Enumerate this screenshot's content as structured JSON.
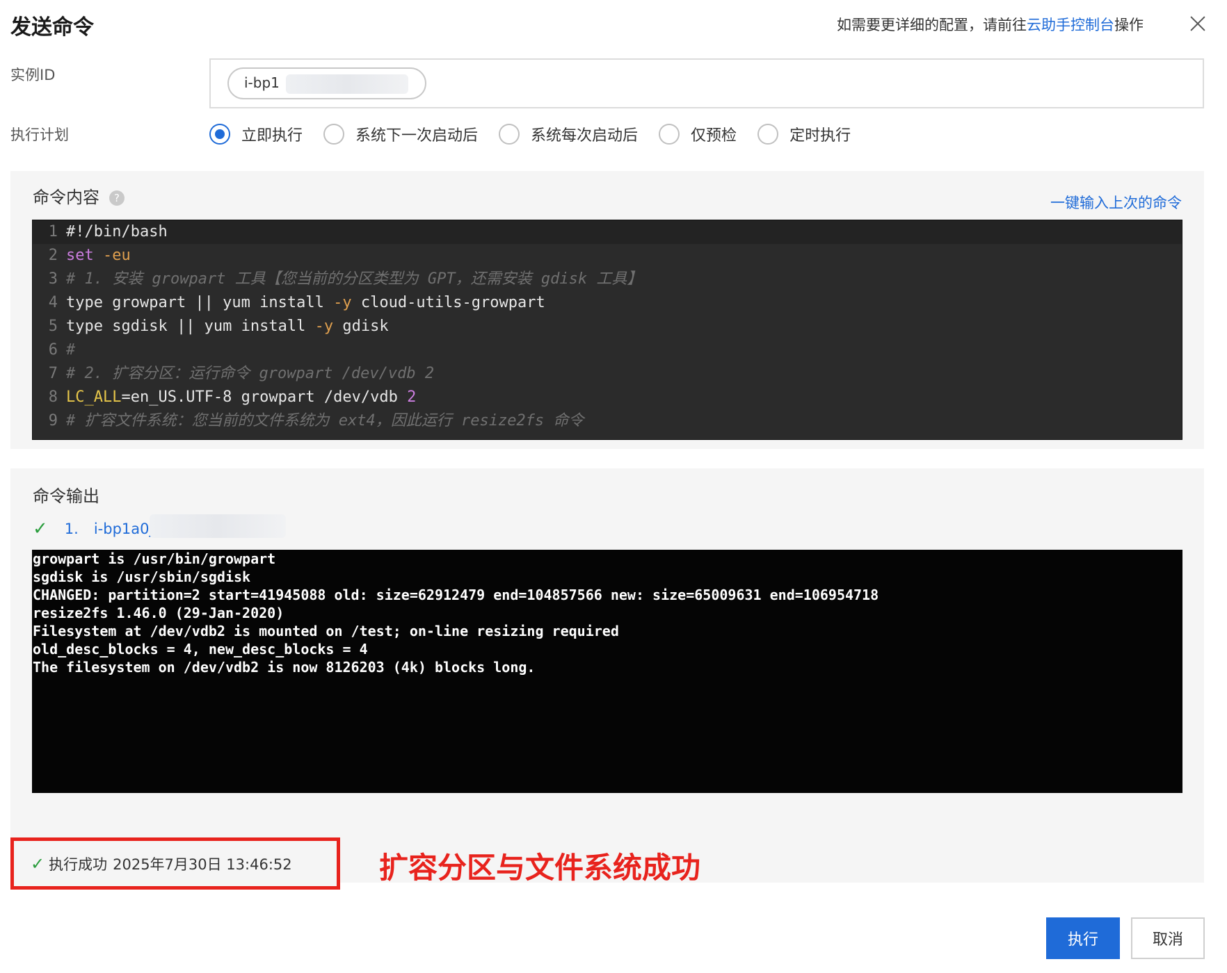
{
  "header": {
    "title": "发送命令",
    "hint_prefix": "如需要更详细的配置，请前往",
    "hint_link": "云助手控制台",
    "hint_suffix": "操作"
  },
  "instance": {
    "label": "实例ID",
    "tag_text": "i-bp1"
  },
  "schedule": {
    "label": "执行计划",
    "options": [
      {
        "label": "立即执行",
        "checked": true
      },
      {
        "label": "系统下一次启动后",
        "checked": false
      },
      {
        "label": "系统每次启动后",
        "checked": false
      },
      {
        "label": "仅预检",
        "checked": false
      },
      {
        "label": "定时执行",
        "checked": false
      }
    ]
  },
  "command": {
    "title": "命令内容",
    "help_glyph": "?",
    "reuse_link": "一键输入上次的命令",
    "lines": [
      [
        {
          "t": "plain",
          "v": "#!/bin/bash"
        }
      ],
      [
        {
          "t": "kw",
          "v": "set"
        },
        {
          "t": "plain",
          "v": " "
        },
        {
          "t": "flag",
          "v": "-eu"
        }
      ],
      [
        {
          "t": "comment",
          "v": "# 1. 安装 growpart 工具【您当前的分区类型为 GPT，还需安装 gdisk 工具】"
        }
      ],
      [
        {
          "t": "plain",
          "v": "type growpart || yum install "
        },
        {
          "t": "flag",
          "v": "-y"
        },
        {
          "t": "plain",
          "v": " cloud-utils-growpart"
        }
      ],
      [
        {
          "t": "plain",
          "v": "type sgdisk || yum install "
        },
        {
          "t": "flag",
          "v": "-y"
        },
        {
          "t": "plain",
          "v": " gdisk"
        }
      ],
      [
        {
          "t": "comment",
          "v": "#"
        }
      ],
      [
        {
          "t": "comment",
          "v": "# 2. 扩容分区：运行命令 growpart /dev/vdb 2"
        }
      ],
      [
        {
          "t": "var",
          "v": "LC_ALL"
        },
        {
          "t": "plain",
          "v": "=en_US.UTF-8 growpart /dev/vdb "
        },
        {
          "t": "num",
          "v": "2"
        }
      ],
      [
        {
          "t": "comment",
          "v": "# 扩容文件系统：您当前的文件系统为 ext4，因此运行 resize2fs 命令"
        }
      ]
    ]
  },
  "output": {
    "title": "命令输出",
    "item_index": "1.",
    "item_id": "i-bp1a0j",
    "lines": [
      "growpart is /usr/bin/growpart",
      "sgdisk is /usr/sbin/sgdisk",
      "CHANGED: partition=2 start=41945088 old: size=62912479 end=104857566 new: size=65009631 end=106954718",
      "resize2fs 1.46.0 (29-Jan-2020)",
      "Filesystem at /dev/vdb2 is mounted on /test; on-line resizing required",
      "old_desc_blocks = 4, new_desc_blocks = 4",
      "The filesystem on /dev/vdb2 is now 8126203 (4k) blocks long."
    ],
    "status_text": "执行成功",
    "status_time": "2025年7月30日 13:46:52"
  },
  "annotation": "扩容分区与文件系统成功",
  "actions": {
    "execute": "执行",
    "cancel": "取消"
  },
  "colors": {
    "accent": "#1f6bd8",
    "success": "#2a9d3d",
    "highlight": "#e8231d"
  }
}
